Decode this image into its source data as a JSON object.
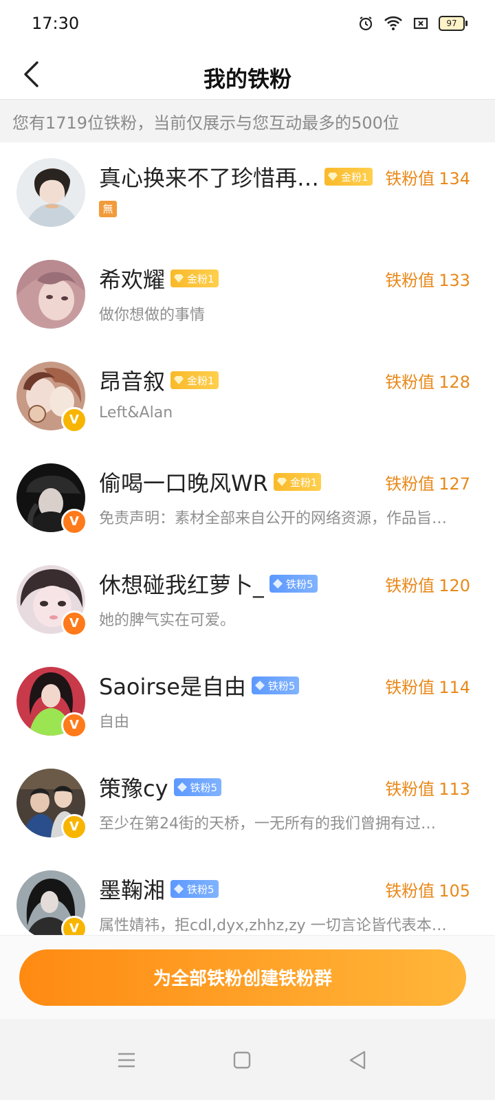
{
  "status_bar": {
    "time": "17:30",
    "battery": "97"
  },
  "header": {
    "title": "我的铁粉"
  },
  "notice": {
    "text": "您有1719位铁粉，当前仅展示与您互动最多的500位"
  },
  "fans": [
    {
      "name": "真心换来不了珍惜再…",
      "badge": "金粉1",
      "badge_type": "gold",
      "value_label": "铁粉值",
      "value": "134",
      "desc": "",
      "tag": "無",
      "verified": ""
    },
    {
      "name": "希欢耀",
      "badge": "金粉1",
      "badge_type": "gold",
      "value_label": "铁粉值",
      "value": "133",
      "desc": "做你想做的事情",
      "verified": ""
    },
    {
      "name": "昂音叙",
      "badge": "金粉1",
      "badge_type": "gold",
      "value_label": "铁粉值",
      "value": "128",
      "desc": "Left&Alan",
      "verified": "yellow"
    },
    {
      "name": "偷喝一口晚风WR",
      "badge": "金粉1",
      "badge_type": "gold",
      "value_label": "铁粉值",
      "value": "127",
      "desc": "免责声明：素材全部来自公开的网络资源，作品旨…",
      "verified": "orange"
    },
    {
      "name": "休想碰我红萝卜_",
      "badge": "铁粉5",
      "badge_type": "iron",
      "value_label": "铁粉值",
      "value": "120",
      "desc": "她的脾气实在可爱。",
      "verified": "orange"
    },
    {
      "name": "Saoirse是自由",
      "badge": "铁粉5",
      "badge_type": "iron",
      "value_label": "铁粉值",
      "value": "114",
      "desc": "自由",
      "verified": "orange"
    },
    {
      "name": "策豫cy",
      "badge": "铁粉5",
      "badge_type": "iron",
      "value_label": "铁粉值",
      "value": "113",
      "desc": "至少在第24街的天桥，一无所有的我们曾拥有过…",
      "verified": "yellow"
    },
    {
      "name": "墨鞠湘",
      "badge": "铁粉5",
      "badge_type": "iron",
      "value_label": "铁粉值",
      "value": "105",
      "desc": "属性婧祎，拒cdl,dyx,zhhz,zy 一切言论皆代表本…",
      "verified": "yellow"
    }
  ],
  "bottom": {
    "create_button": "为全部铁粉创建铁粉群"
  },
  "colors": {
    "accent": "#ff8a12",
    "value_text": "#e8891a",
    "gold_badge": "#f9b92a",
    "iron_badge": "#5c98ff",
    "verified_yellow": "#f7b500",
    "verified_orange": "#ff7a1a"
  },
  "icons": {
    "back": "chevron-left-icon",
    "alarm": "alarm-icon",
    "wifi": "wifi-icon",
    "sim": "no-sim-icon",
    "battery": "battery-icon",
    "gem": "gem-icon",
    "menu": "menu-icon",
    "home": "home-square-icon",
    "back_nav": "back-triangle-icon"
  }
}
